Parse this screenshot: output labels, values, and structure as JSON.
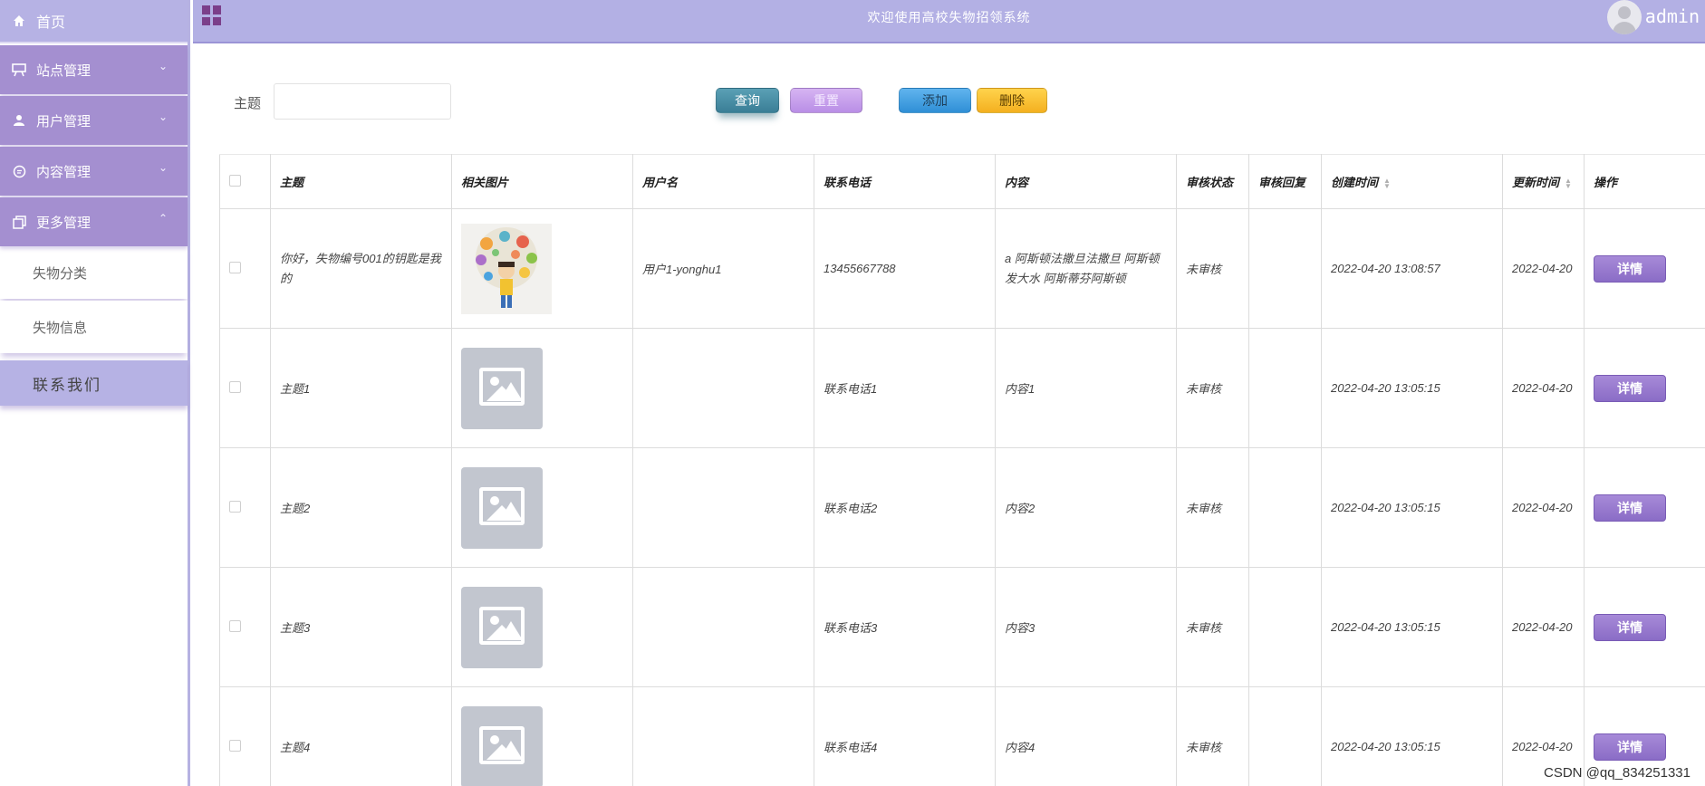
{
  "sidebar": {
    "home_label": "首页",
    "menus": [
      {
        "label": "站点管理"
      },
      {
        "label": "用户管理"
      },
      {
        "label": "内容管理"
      },
      {
        "label": "更多管理"
      }
    ],
    "submenus": [
      {
        "label": "失物分类"
      },
      {
        "label": "失物信息"
      }
    ],
    "contact_label": "联系我们"
  },
  "topbar": {
    "title": "欢迎使用高校失物招领系统",
    "user": "admin"
  },
  "search": {
    "label": "主题",
    "value": "",
    "query_button": "查询",
    "reset_button": "重置",
    "add_button": "添加",
    "delete_button": "删除"
  },
  "table": {
    "headers": [
      "主题",
      "相关图片",
      "用户名",
      "联系电话",
      "内容",
      "审核状态",
      "审核回复",
      "创建时间",
      "更新时间",
      "操作"
    ],
    "rows": [
      {
        "subject": "你好，失物编号001的钥匙是我的",
        "image": "photo",
        "username": "用户1-yonghu1",
        "phone": "13455667788",
        "content": "a 阿斯顿法撒旦法撒旦 阿斯顿发大水 阿斯蒂芬阿斯顿",
        "status": "未审核",
        "reply": "",
        "created": "2022-04-20 13:08:57",
        "updated": "2022-04-20",
        "action": "详情"
      },
      {
        "subject": "主题1",
        "image": "placeholder",
        "username": "",
        "phone": "联系电话1",
        "content": "内容1",
        "status": "未审核",
        "reply": "",
        "created": "2022-04-20 13:05:15",
        "updated": "2022-04-20",
        "action": "详情"
      },
      {
        "subject": "主题2",
        "image": "placeholder",
        "username": "",
        "phone": "联系电话2",
        "content": "内容2",
        "status": "未审核",
        "reply": "",
        "created": "2022-04-20 13:05:15",
        "updated": "2022-04-20",
        "action": "详情"
      },
      {
        "subject": "主题3",
        "image": "placeholder",
        "username": "",
        "phone": "联系电话3",
        "content": "内容3",
        "status": "未审核",
        "reply": "",
        "created": "2022-04-20 13:05:15",
        "updated": "2022-04-20",
        "action": "详情"
      },
      {
        "subject": "主题4",
        "image": "placeholder",
        "username": "",
        "phone": "联系电话4",
        "content": "内容4",
        "status": "未审核",
        "reply": "",
        "created": "2022-04-20 13:05:15",
        "updated": "2022-04-20",
        "action": "详情"
      }
    ]
  },
  "watermark": "CSDN @qq_834251331",
  "colors": {
    "topbar": "#b3b0e4",
    "sidebar_menu": "#a48fd0",
    "detail_button": "#8a6cc6",
    "query_button": "#3a7e96"
  }
}
